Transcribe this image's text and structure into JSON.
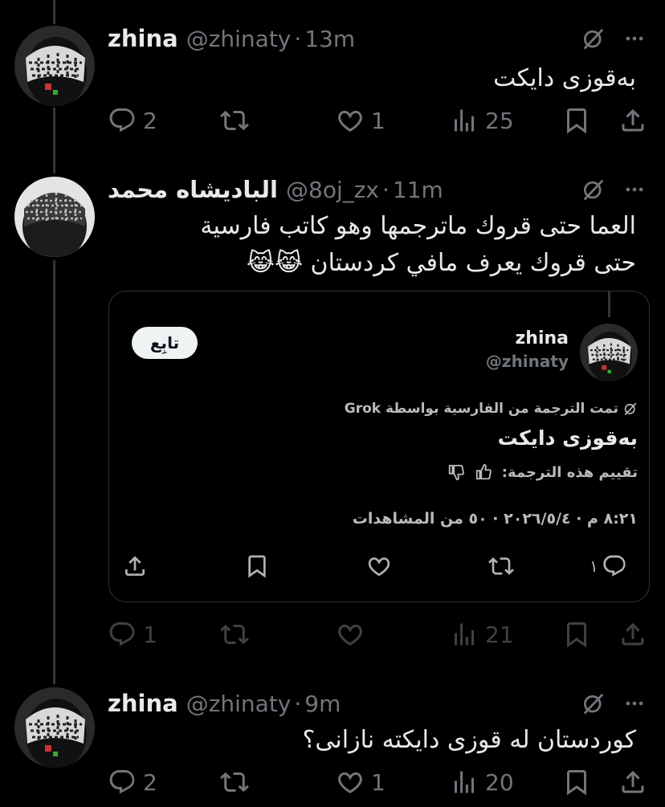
{
  "tweet1": {
    "name": "zhina",
    "handle": "@zhinaty",
    "separator": "·",
    "time": "13m",
    "text": "بەقوزی دایکت",
    "replies": "2",
    "retweets": "",
    "likes": "1",
    "views": "25"
  },
  "tweet2": {
    "name": "الباديشاه محمد",
    "handle": "@8oj_zx",
    "separator": "·",
    "time": "11m",
    "text_line1": "العما حتى قروك ماترجمها وهو كاتب فارسية",
    "text_line2": "حتى قروك يعرف مافي كردستان 😹😹",
    "replies": "1",
    "likes": "",
    "views": "21",
    "quote": {
      "name": "zhina",
      "handle": "@zhinaty",
      "follow_label": "تابِع",
      "translated_note": "تمت الترجمة من الفارسية بواسطة Grok",
      "translated_text": "بەقوزی دایکت",
      "rate_label": "تقييم هذه الترجمة:",
      "meta": "٨:٢١ م · ٢٠٢٦/٥/٤ · ٥٠ من المشاهدات",
      "replies": "١"
    }
  },
  "tweet3": {
    "name": "zhina",
    "handle": "@zhinaty",
    "separator": "·",
    "time": "9m",
    "text": "کوردستان لە قوزی دایکتە نازانی؟",
    "replies": "2",
    "likes": "1",
    "views": "20"
  },
  "icons": {
    "grok": "grok-slash-icon",
    "more": "more-dots-icon",
    "reply": "reply-bubble-icon",
    "retweet": "retweet-icon",
    "like": "heart-icon",
    "views": "views-bars-icon",
    "bookmark": "bookmark-icon",
    "share": "share-icon"
  },
  "colors": {
    "background": "#000000",
    "text": "#e7e9ea",
    "muted": "#71767b",
    "border": "#2f3336"
  }
}
